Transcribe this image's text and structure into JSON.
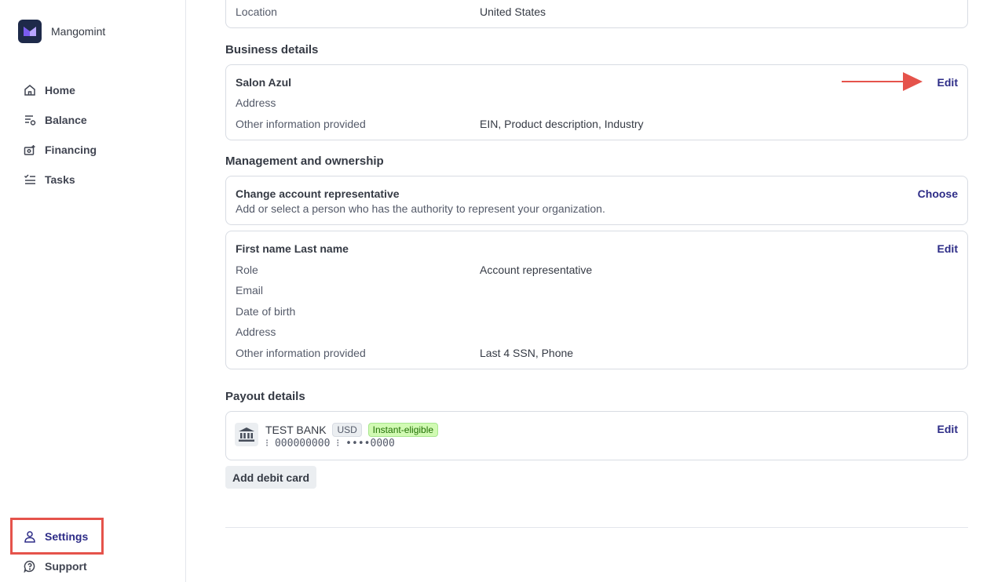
{
  "brand": {
    "name": "Mangomint"
  },
  "nav": {
    "items": [
      {
        "label": "Home",
        "icon": "home-icon"
      },
      {
        "label": "Balance",
        "icon": "balance-icon"
      },
      {
        "label": "Financing",
        "icon": "financing-icon"
      },
      {
        "label": "Tasks",
        "icon": "tasks-icon"
      }
    ],
    "bottom": [
      {
        "label": "Settings",
        "icon": "person-icon",
        "active": true
      },
      {
        "label": "Support",
        "icon": "help-icon"
      }
    ]
  },
  "top_card": {
    "label": "Location",
    "value": "United States"
  },
  "business": {
    "title": "Business details",
    "name": "Salon Azul",
    "edit": "Edit",
    "rows": [
      {
        "label": "Address",
        "value": ""
      },
      {
        "label": "Other information provided",
        "value": "EIN, Product description, Industry"
      }
    ]
  },
  "management": {
    "title": "Management and ownership",
    "rep_card": {
      "title": "Change account representative",
      "subtitle": "Add or select a person who has the authority to represent your organization.",
      "action": "Choose"
    },
    "person": {
      "name": "First name Last name",
      "edit": "Edit",
      "rows": [
        {
          "label": "Role",
          "value": "Account representative"
        },
        {
          "label": "Email",
          "value": ""
        },
        {
          "label": "Date of birth",
          "value": ""
        },
        {
          "label": "Address",
          "value": ""
        },
        {
          "label": "Other information provided",
          "value": "Last 4 SSN, Phone"
        }
      ]
    }
  },
  "payout": {
    "title": "Payout details",
    "bank_name": "TEST BANK",
    "currency_badge": "USD",
    "instant_badge": "Instant-eligible",
    "account_line": "⁝ 000000000 ⁝ ••••0000",
    "edit": "Edit",
    "add_debit_card": "Add debit card"
  },
  "colors": {
    "accent": "#2d2c87",
    "highlight": "#e5534b",
    "arrow": "#e5534b"
  }
}
